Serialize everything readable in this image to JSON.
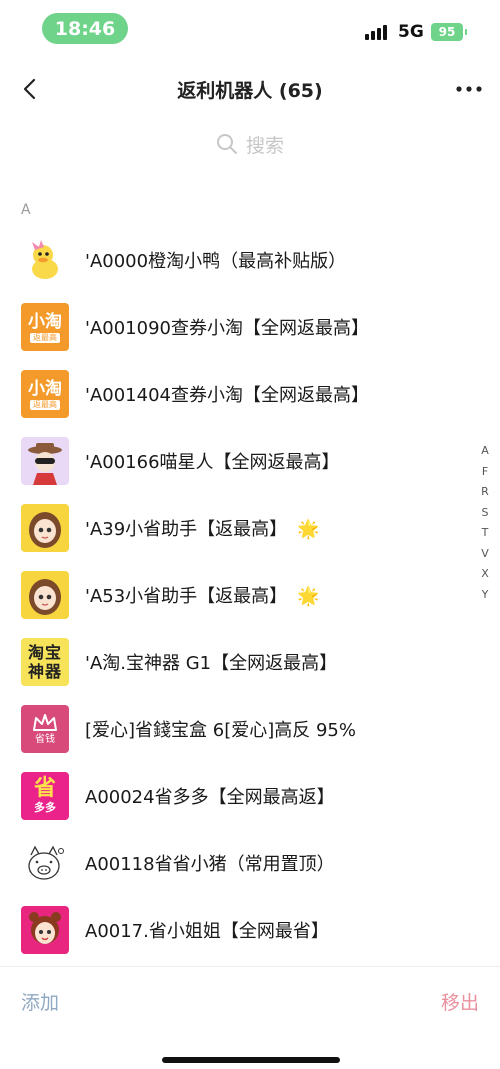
{
  "status_bar": {
    "time": "18:46",
    "network": "5G",
    "battery": "95"
  },
  "nav": {
    "title": "返利机器人 (65)"
  },
  "search": {
    "placeholder": "搜索"
  },
  "section": {
    "letter": "A"
  },
  "list": [
    {
      "name": "'A0000橙淘小鸭（最高补贴版）",
      "star": ""
    },
    {
      "name": "'A001090查券小淘【全网返最高】",
      "star": ""
    },
    {
      "name": "'A001404查券小淘【全网返最高】",
      "star": ""
    },
    {
      "name": "'A00166喵星人【全网返最高】",
      "star": ""
    },
    {
      "name": "'A39小省助手【返最高】",
      "star": "🌟"
    },
    {
      "name": "'A53小省助手【返最高】",
      "star": "🌟"
    },
    {
      "name": "'A淘.宝神器 G1【全网返最高】",
      "star": ""
    },
    {
      "name": "[爱心]省錢宝盒 6[爱心]高反 95%",
      "star": ""
    },
    {
      "name": "A00024省多多【全网最高返】",
      "star": ""
    },
    {
      "name": "A00118省省小猪（常用置顶）",
      "star": ""
    },
    {
      "name": "A0017.省小姐姐【全网最省】",
      "star": ""
    }
  ],
  "avatar_text": {
    "xiaotao": "小淘",
    "xiaotao_sub": "返最高",
    "taobao_1": "淘宝",
    "taobao_2": "神器",
    "shengqian": "省钱",
    "shengduo_1": "省",
    "shengduo_2": "多多"
  },
  "index_bar": [
    "A",
    "F",
    "R",
    "S",
    "T",
    "V",
    "X",
    "Y"
  ],
  "bottom": {
    "add": "添加",
    "remove": "移出"
  },
  "colors": {
    "status_green": "#6fd38a",
    "add_blue": "#8fa8c4",
    "remove_pink": "#e8909e"
  }
}
